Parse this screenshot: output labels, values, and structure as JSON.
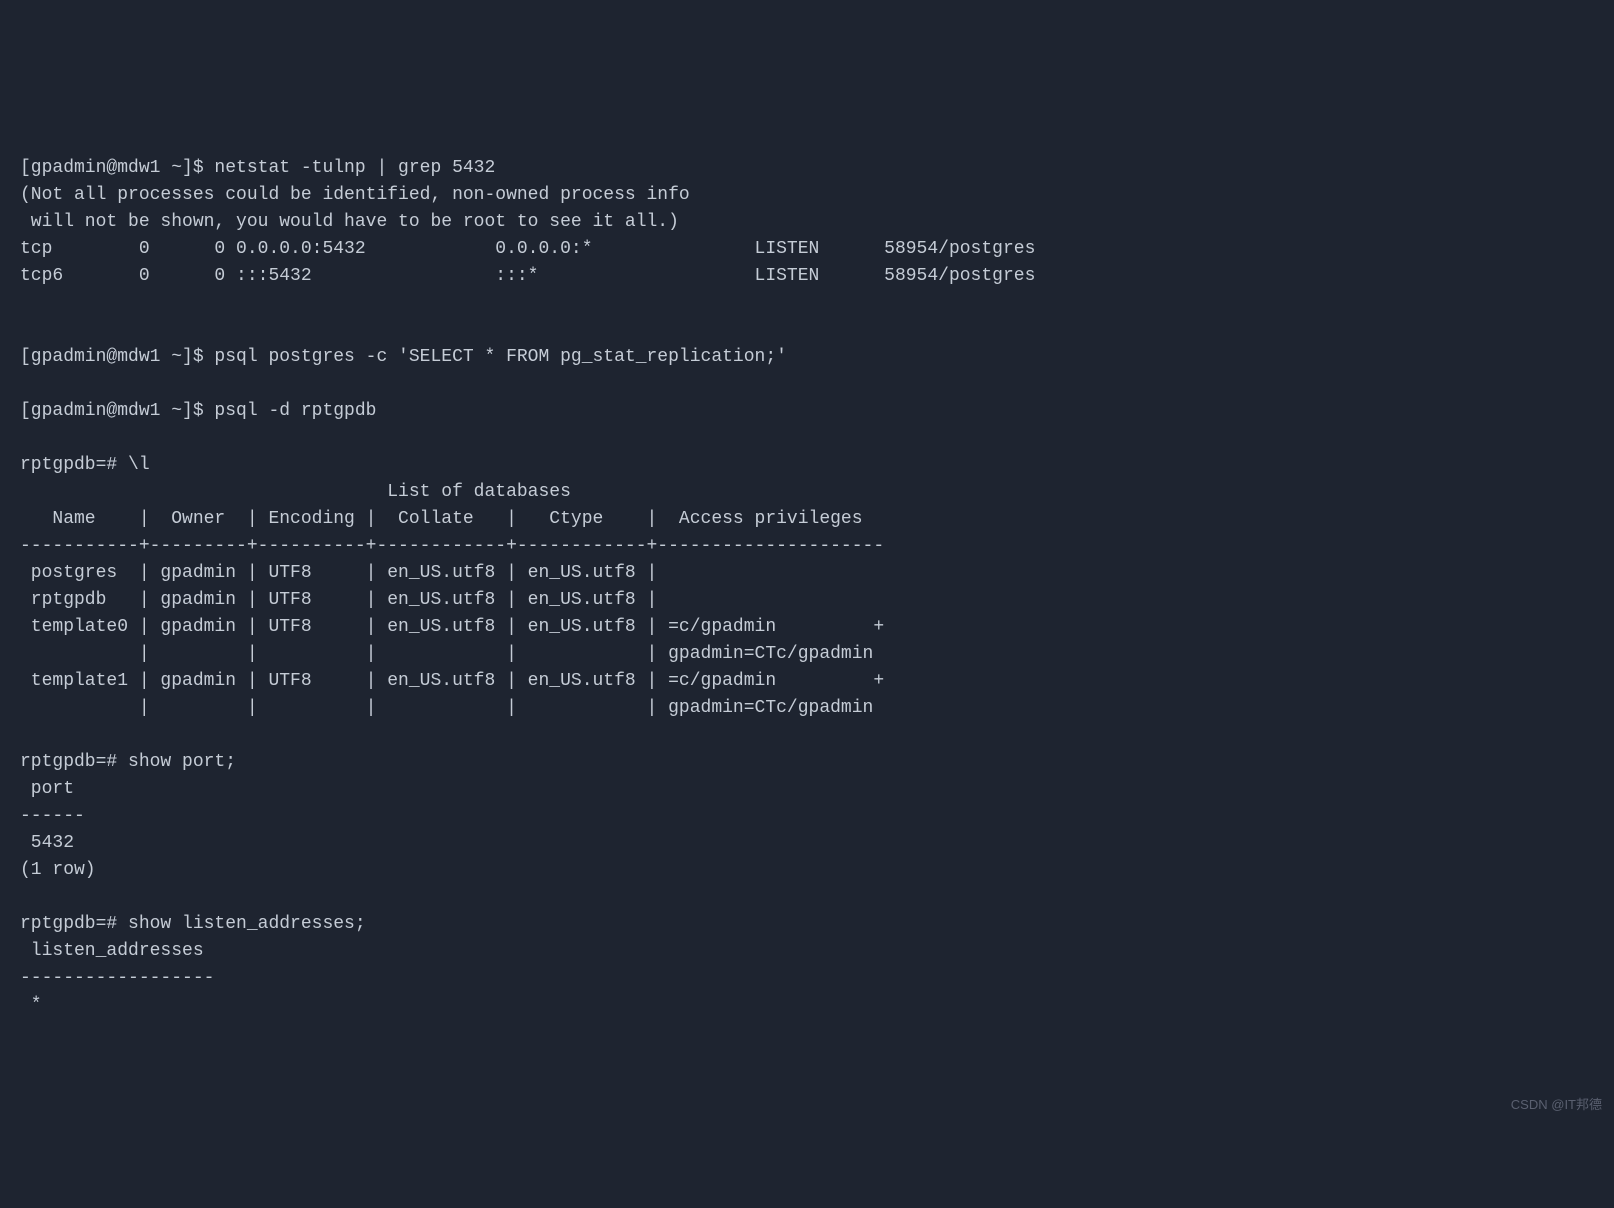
{
  "lines": {
    "l1": "[gpadmin@mdw1 ~]$ netstat -tulnp | grep 5432",
    "l2": "(Not all processes could be identified, non-owned process info",
    "l3": " will not be shown, you would have to be root to see it all.)",
    "l4": "tcp        0      0 0.0.0.0:5432            0.0.0.0:*               LISTEN      58954/postgres",
    "l5": "tcp6       0      0 :::5432                 :::*                    LISTEN      58954/postgres",
    "l6": "",
    "l7": "",
    "l8": "[gpadmin@mdw1 ~]$ psql postgres -c 'SELECT * FROM pg_stat_replication;'",
    "l9": "",
    "l10": "[gpadmin@mdw1 ~]$ psql -d rptgpdb",
    "l11": "",
    "l12": "rptgpdb=# \\l",
    "l13": "                                  List of databases",
    "l14": "   Name    |  Owner  | Encoding |  Collate   |   Ctype    |  Access privileges  ",
    "l15": "-----------+---------+----------+------------+------------+---------------------",
    "l16": " postgres  | gpadmin | UTF8     | en_US.utf8 | en_US.utf8 | ",
    "l17": " rptgpdb   | gpadmin | UTF8     | en_US.utf8 | en_US.utf8 | ",
    "l18": " template0 | gpadmin | UTF8     | en_US.utf8 | en_US.utf8 | =c/gpadmin         +",
    "l19": "           |         |          |            |            | gpadmin=CTc/gpadmin",
    "l20": " template1 | gpadmin | UTF8     | en_US.utf8 | en_US.utf8 | =c/gpadmin         +",
    "l21": "           |         |          |            |            | gpadmin=CTc/gpadmin",
    "l22": "",
    "l23": "rptgpdb=# show port;",
    "l24": " port ",
    "l25": "------",
    "l26": " 5432",
    "l27": "(1 row)",
    "l28": "",
    "l29": "rptgpdb=# show listen_addresses;",
    "l30": " listen_addresses ",
    "l31": "------------------",
    "l32": " *"
  },
  "watermark": "CSDN @IT邦德"
}
